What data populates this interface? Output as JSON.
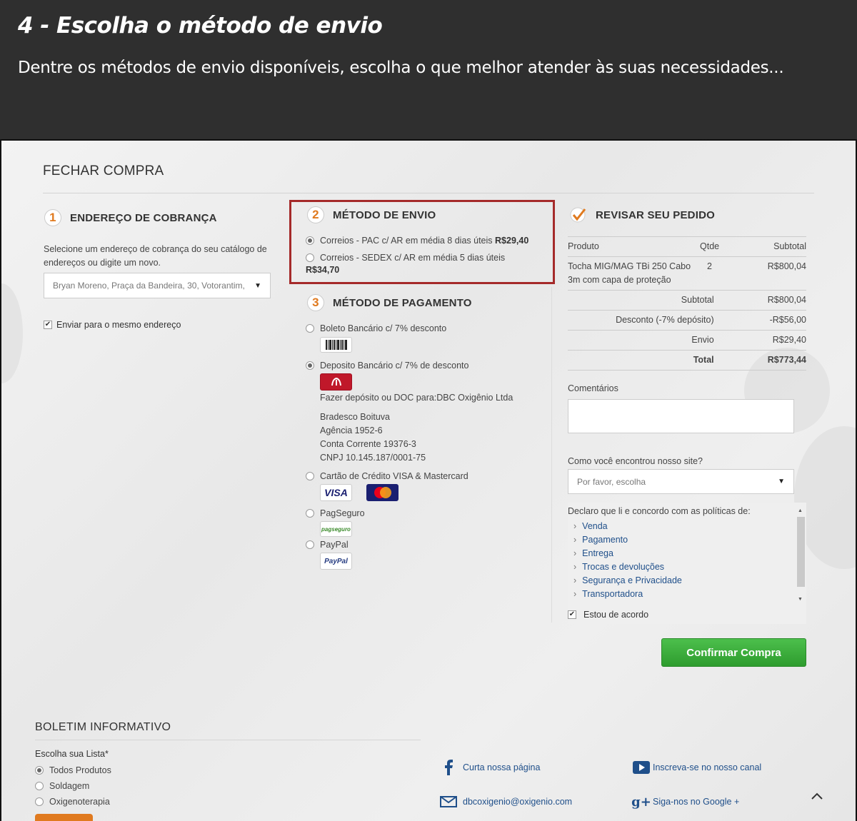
{
  "banner": {
    "title": "4 - Escolha o método de envio",
    "subtitle": "Dentre os métodos de envio disponíveis, escolha o que melhor atender às suas necessidades..."
  },
  "page_title": "FECHAR COMPRA",
  "billing": {
    "number": "1",
    "heading": "ENDEREÇO DE COBRANÇA",
    "hint": "Selecione um endereço de cobrança do seu catálogo de endereços ou digite um novo.",
    "address_selected": "Bryan Moreno, Praça da Bandeira, 30, Votorantim,",
    "same_address_label": "Enviar para o mesmo endereço"
  },
  "shipping": {
    "number": "2",
    "heading": "MÉTODO DE ENVIO",
    "options": [
      {
        "label": "Correios - PAC c/ AR em média 8 dias úteis",
        "price": "R$29,40",
        "selected": true
      },
      {
        "label": "Correios - SEDEX c/ AR em média 5 dias úteis",
        "price": "R$34,70",
        "selected": false
      }
    ]
  },
  "payment": {
    "number": "3",
    "heading": "MÉTODO DE PAGAMENTO",
    "options": [
      {
        "label": "Boleto Bancário c/ 7% desconto"
      },
      {
        "label": "Deposito Bancário c/ 7% de desconto"
      },
      {
        "label": "Cartão de Crédito VISA & Mastercard"
      },
      {
        "label": "PagSeguro"
      },
      {
        "label": "PayPal"
      }
    ],
    "deposit_info": {
      "line1": "Fazer depósito ou DOC para:DBC Oxigênio Ltda",
      "bank": "Bradesco Boituva",
      "agency": "Agência 1952-6",
      "account": "Conta Corrente 19376-3",
      "cnpj": "CNPJ 10.145.187/0001-75"
    },
    "icons": {
      "visa": "VISA",
      "mastercard": "MasterCard",
      "pagseguro": "pagseguro",
      "paypal": "PayPal"
    }
  },
  "review": {
    "heading": "REVISAR SEU PEDIDO",
    "columns": [
      "Produto",
      "Qtde",
      "Subtotal"
    ],
    "item": {
      "name": "Tocha MIG/MAG TBi 250 Cabo 3m com capa de proteção",
      "qty": "2",
      "subtotal": "R$800,04"
    },
    "totals": [
      {
        "label": "Subtotal",
        "value": "R$800,04"
      },
      {
        "label": "Desconto (-7% depósito)",
        "value": "-R$56,00"
      },
      {
        "label": "Envio",
        "value": "R$29,40"
      },
      {
        "label": "Total",
        "value": "R$773,44"
      }
    ],
    "comments_label": "Comentários",
    "found_label": "Como você encontrou nosso site?",
    "found_placeholder": "Por favor, escolha",
    "policy_lead": "Declaro que li e concordo com as políticas de:",
    "policies": [
      "Venda",
      "Pagamento",
      "Entrega",
      "Trocas e devoluções",
      "Segurança e Privacidade",
      "Transportadora"
    ],
    "agree_label": "Estou de acordo",
    "confirm_label": "Confirmar Compra"
  },
  "newsletter": {
    "title": "BOLETIM INFORMATIVO",
    "list_label": "Escolha sua Lista*",
    "options": [
      {
        "label": "Todos Produtos",
        "selected": true
      },
      {
        "label": "Soldagem",
        "selected": false
      },
      {
        "label": "Oxigenoterapia",
        "selected": false
      }
    ]
  },
  "social": {
    "facebook": "Curta nossa página",
    "youtube": "Inscreva-se no nosso canal",
    "email": "dbcoxigenio@oxigenio.com",
    "google": "Siga-nos no Google +"
  },
  "colors": {
    "accent": "#e07a1f",
    "highlight_border": "#a52a2a",
    "confirm": "#3aab3a",
    "link": "#1f4f8a"
  }
}
